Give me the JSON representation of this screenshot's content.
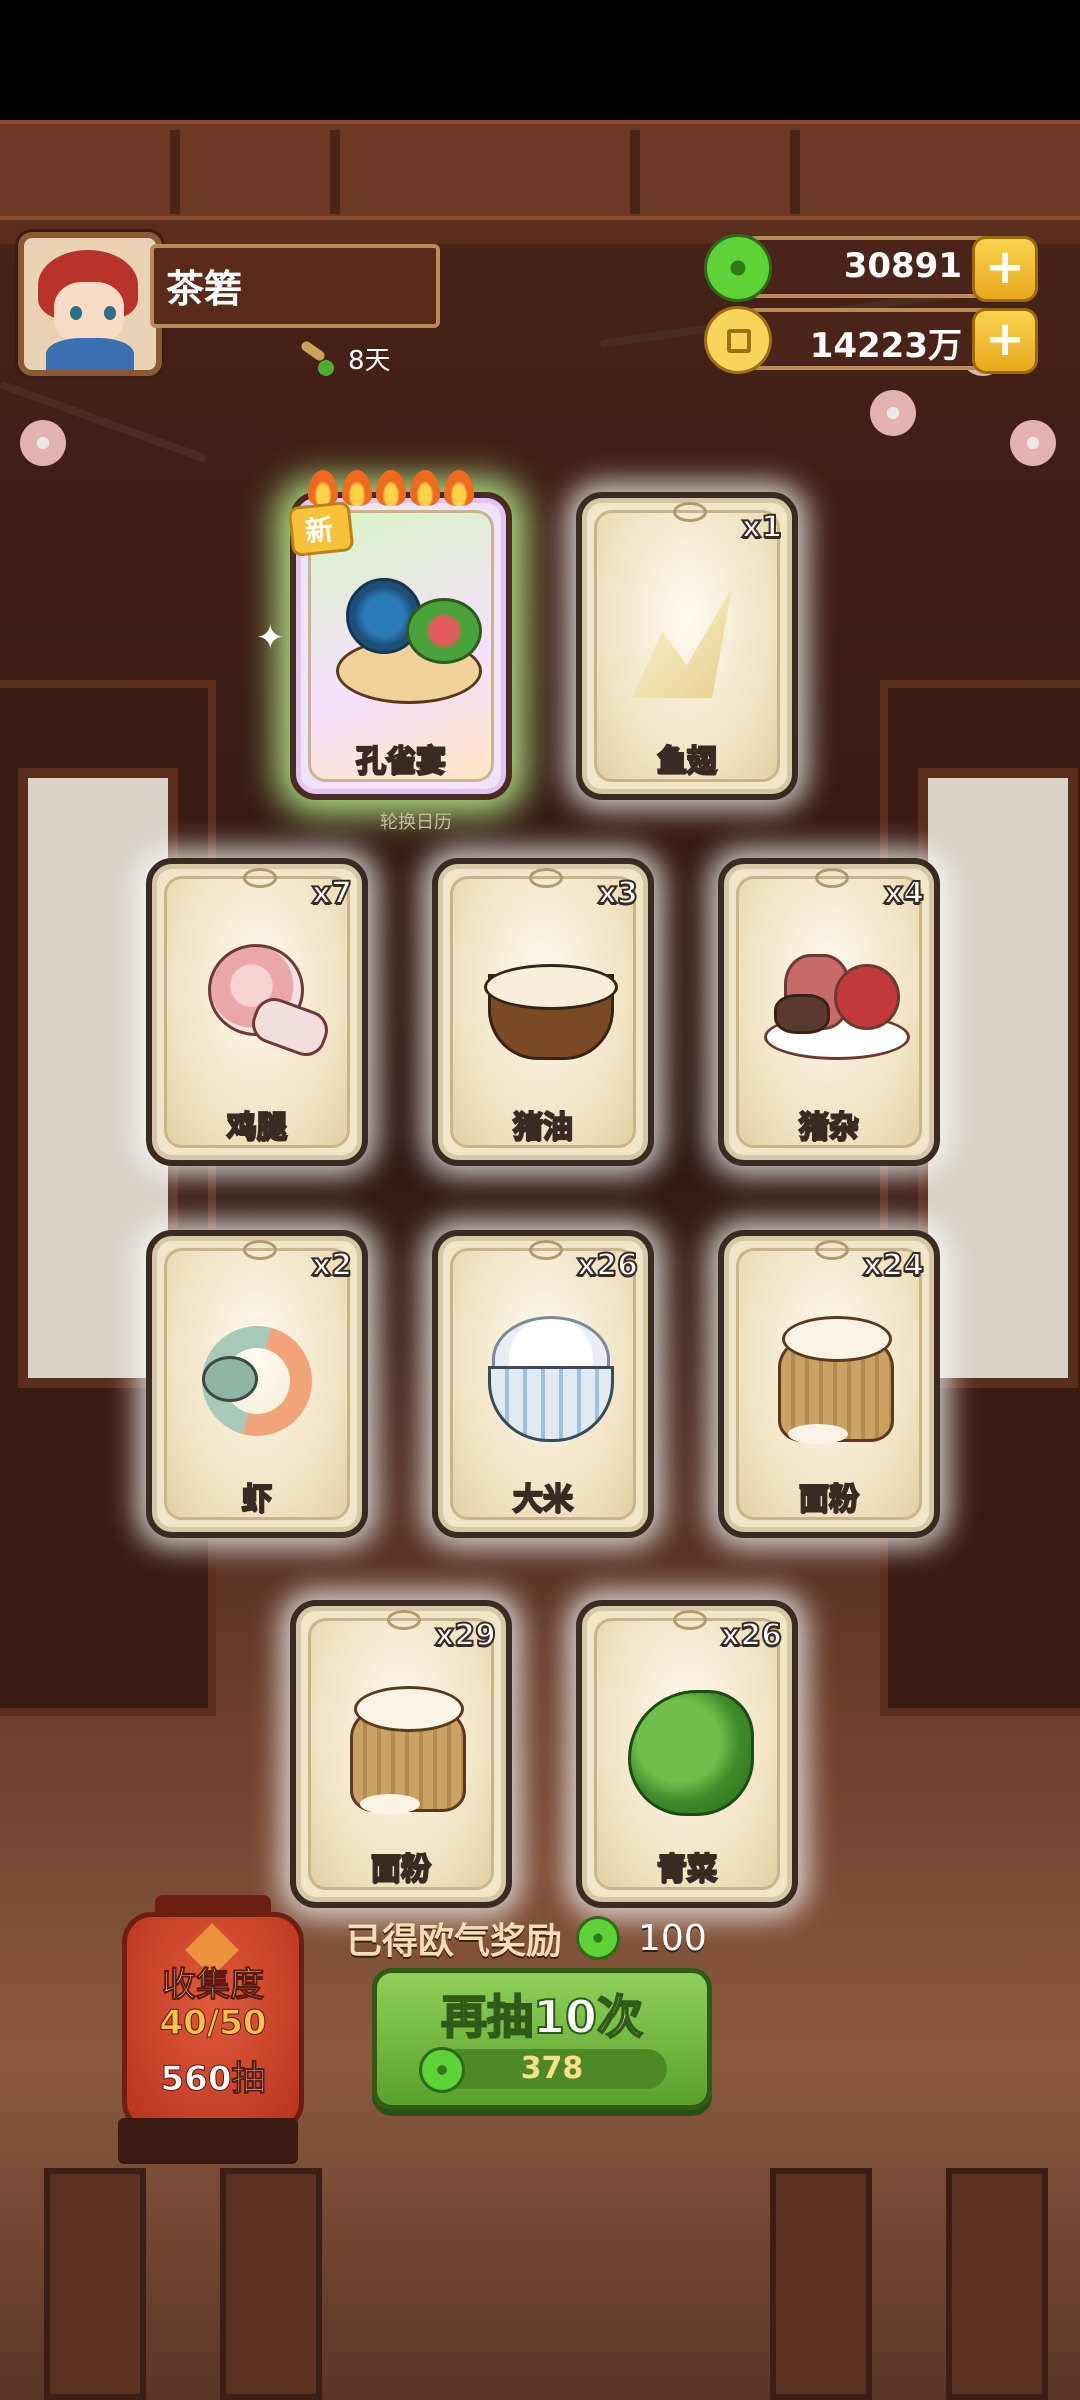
{
  "header": {
    "player_name": "茶箬",
    "days": "8天"
  },
  "currencies": {
    "jade": "30891",
    "coins": "14223万",
    "plus_label": "+"
  },
  "cards": [
    {
      "name": "孔雀宴",
      "count": "",
      "new_tag": "新",
      "special": true
    },
    {
      "name": "鱼翅",
      "count": "x1"
    },
    {
      "name": "鸡腿",
      "count": "x7"
    },
    {
      "name": "猪油",
      "count": "x3"
    },
    {
      "name": "猪杂",
      "count": "x4"
    },
    {
      "name": "虾",
      "count": "x2"
    },
    {
      "name": "大米",
      "count": "x26"
    },
    {
      "name": "面粉",
      "count": "x24"
    },
    {
      "name": "面粉",
      "count": "x29"
    },
    {
      "name": "青菜",
      "count": "x26"
    }
  ],
  "rotate_calendar": "轮换日历",
  "reward": {
    "label": "已得欧气奖励",
    "amount": "100"
  },
  "collection": {
    "title": "收集度",
    "progress": "40/50",
    "draws": "560抽"
  },
  "draw_button": {
    "label": "再抽10次",
    "cost": "378"
  }
}
